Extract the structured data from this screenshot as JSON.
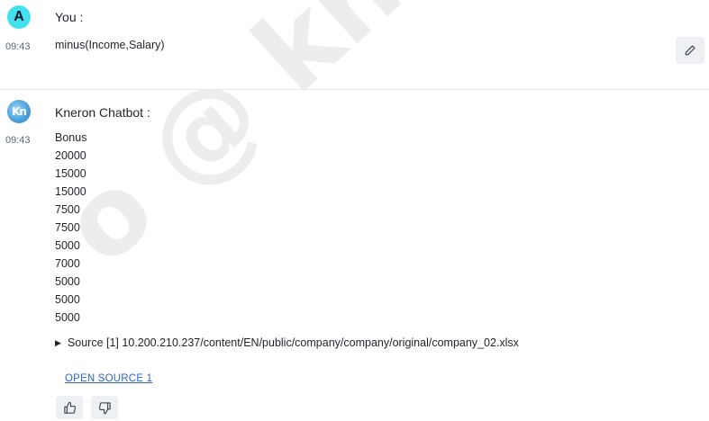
{
  "user_message": {
    "avatar_letter": "A",
    "sender": "You :",
    "time": "09:43",
    "text": "minus(Income,Salary)",
    "edit_icon": "pencil-icon"
  },
  "bot_message": {
    "avatar_text": "Kn",
    "sender": "Kneron Chatbot :",
    "time": "09:43",
    "lines": [
      "Bonus",
      "20000",
      "15000",
      "15000",
      "7500",
      "7500",
      "5000",
      "7000",
      "5000",
      "5000",
      "5000"
    ],
    "source_label": "Source [1] 10.200.210.237/content/EN/public/company/company/original/company_02.xlsx",
    "open_source_label": "OPEN SOURCE 1",
    "feedback_icons": [
      "thumbs-up-icon",
      "thumbs-down-icon"
    ]
  },
  "watermark": "o @ kneron",
  "colors": {
    "user_avatar": "#43e0ee",
    "link": "#2e63c7",
    "button_bg": "#eef0f3"
  }
}
